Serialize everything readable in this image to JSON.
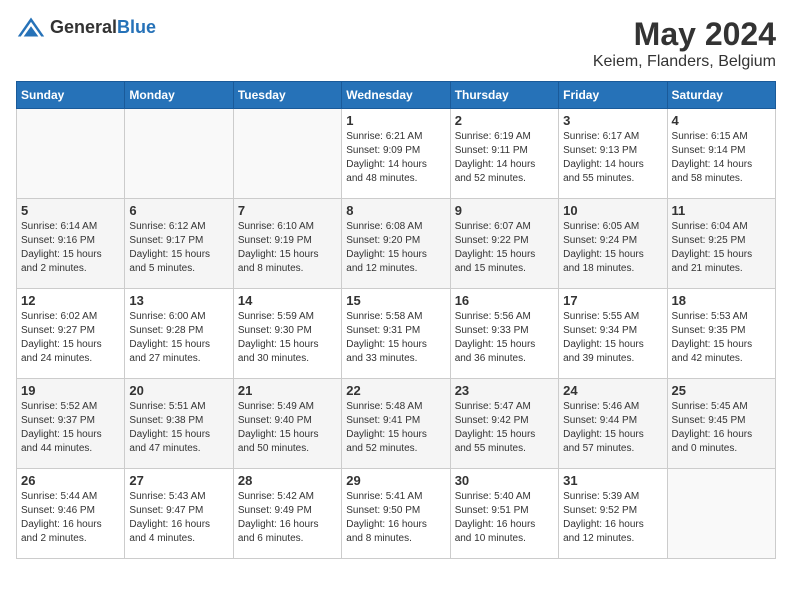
{
  "header": {
    "logo_general": "General",
    "logo_blue": "Blue",
    "month_year": "May 2024",
    "location": "Keiem, Flanders, Belgium"
  },
  "columns": [
    "Sunday",
    "Monday",
    "Tuesday",
    "Wednesday",
    "Thursday",
    "Friday",
    "Saturday"
  ],
  "weeks": [
    {
      "cells": [
        {
          "day": "",
          "info": ""
        },
        {
          "day": "",
          "info": ""
        },
        {
          "day": "",
          "info": ""
        },
        {
          "day": "1",
          "info": "Sunrise: 6:21 AM\nSunset: 9:09 PM\nDaylight: 14 hours\nand 48 minutes."
        },
        {
          "day": "2",
          "info": "Sunrise: 6:19 AM\nSunset: 9:11 PM\nDaylight: 14 hours\nand 52 minutes."
        },
        {
          "day": "3",
          "info": "Sunrise: 6:17 AM\nSunset: 9:13 PM\nDaylight: 14 hours\nand 55 minutes."
        },
        {
          "day": "4",
          "info": "Sunrise: 6:15 AM\nSunset: 9:14 PM\nDaylight: 14 hours\nand 58 minutes."
        }
      ]
    },
    {
      "cells": [
        {
          "day": "5",
          "info": "Sunrise: 6:14 AM\nSunset: 9:16 PM\nDaylight: 15 hours\nand 2 minutes."
        },
        {
          "day": "6",
          "info": "Sunrise: 6:12 AM\nSunset: 9:17 PM\nDaylight: 15 hours\nand 5 minutes."
        },
        {
          "day": "7",
          "info": "Sunrise: 6:10 AM\nSunset: 9:19 PM\nDaylight: 15 hours\nand 8 minutes."
        },
        {
          "day": "8",
          "info": "Sunrise: 6:08 AM\nSunset: 9:20 PM\nDaylight: 15 hours\nand 12 minutes."
        },
        {
          "day": "9",
          "info": "Sunrise: 6:07 AM\nSunset: 9:22 PM\nDaylight: 15 hours\nand 15 minutes."
        },
        {
          "day": "10",
          "info": "Sunrise: 6:05 AM\nSunset: 9:24 PM\nDaylight: 15 hours\nand 18 minutes."
        },
        {
          "day": "11",
          "info": "Sunrise: 6:04 AM\nSunset: 9:25 PM\nDaylight: 15 hours\nand 21 minutes."
        }
      ]
    },
    {
      "cells": [
        {
          "day": "12",
          "info": "Sunrise: 6:02 AM\nSunset: 9:27 PM\nDaylight: 15 hours\nand 24 minutes."
        },
        {
          "day": "13",
          "info": "Sunrise: 6:00 AM\nSunset: 9:28 PM\nDaylight: 15 hours\nand 27 minutes."
        },
        {
          "day": "14",
          "info": "Sunrise: 5:59 AM\nSunset: 9:30 PM\nDaylight: 15 hours\nand 30 minutes."
        },
        {
          "day": "15",
          "info": "Sunrise: 5:58 AM\nSunset: 9:31 PM\nDaylight: 15 hours\nand 33 minutes."
        },
        {
          "day": "16",
          "info": "Sunrise: 5:56 AM\nSunset: 9:33 PM\nDaylight: 15 hours\nand 36 minutes."
        },
        {
          "day": "17",
          "info": "Sunrise: 5:55 AM\nSunset: 9:34 PM\nDaylight: 15 hours\nand 39 minutes."
        },
        {
          "day": "18",
          "info": "Sunrise: 5:53 AM\nSunset: 9:35 PM\nDaylight: 15 hours\nand 42 minutes."
        }
      ]
    },
    {
      "cells": [
        {
          "day": "19",
          "info": "Sunrise: 5:52 AM\nSunset: 9:37 PM\nDaylight: 15 hours\nand 44 minutes."
        },
        {
          "day": "20",
          "info": "Sunrise: 5:51 AM\nSunset: 9:38 PM\nDaylight: 15 hours\nand 47 minutes."
        },
        {
          "day": "21",
          "info": "Sunrise: 5:49 AM\nSunset: 9:40 PM\nDaylight: 15 hours\nand 50 minutes."
        },
        {
          "day": "22",
          "info": "Sunrise: 5:48 AM\nSunset: 9:41 PM\nDaylight: 15 hours\nand 52 minutes."
        },
        {
          "day": "23",
          "info": "Sunrise: 5:47 AM\nSunset: 9:42 PM\nDaylight: 15 hours\nand 55 minutes."
        },
        {
          "day": "24",
          "info": "Sunrise: 5:46 AM\nSunset: 9:44 PM\nDaylight: 15 hours\nand 57 minutes."
        },
        {
          "day": "25",
          "info": "Sunrise: 5:45 AM\nSunset: 9:45 PM\nDaylight: 16 hours\nand 0 minutes."
        }
      ]
    },
    {
      "cells": [
        {
          "day": "26",
          "info": "Sunrise: 5:44 AM\nSunset: 9:46 PM\nDaylight: 16 hours\nand 2 minutes."
        },
        {
          "day": "27",
          "info": "Sunrise: 5:43 AM\nSunset: 9:47 PM\nDaylight: 16 hours\nand 4 minutes."
        },
        {
          "day": "28",
          "info": "Sunrise: 5:42 AM\nSunset: 9:49 PM\nDaylight: 16 hours\nand 6 minutes."
        },
        {
          "day": "29",
          "info": "Sunrise: 5:41 AM\nSunset: 9:50 PM\nDaylight: 16 hours\nand 8 minutes."
        },
        {
          "day": "30",
          "info": "Sunrise: 5:40 AM\nSunset: 9:51 PM\nDaylight: 16 hours\nand 10 minutes."
        },
        {
          "day": "31",
          "info": "Sunrise: 5:39 AM\nSunset: 9:52 PM\nDaylight: 16 hours\nand 12 minutes."
        },
        {
          "day": "",
          "info": ""
        }
      ]
    }
  ]
}
